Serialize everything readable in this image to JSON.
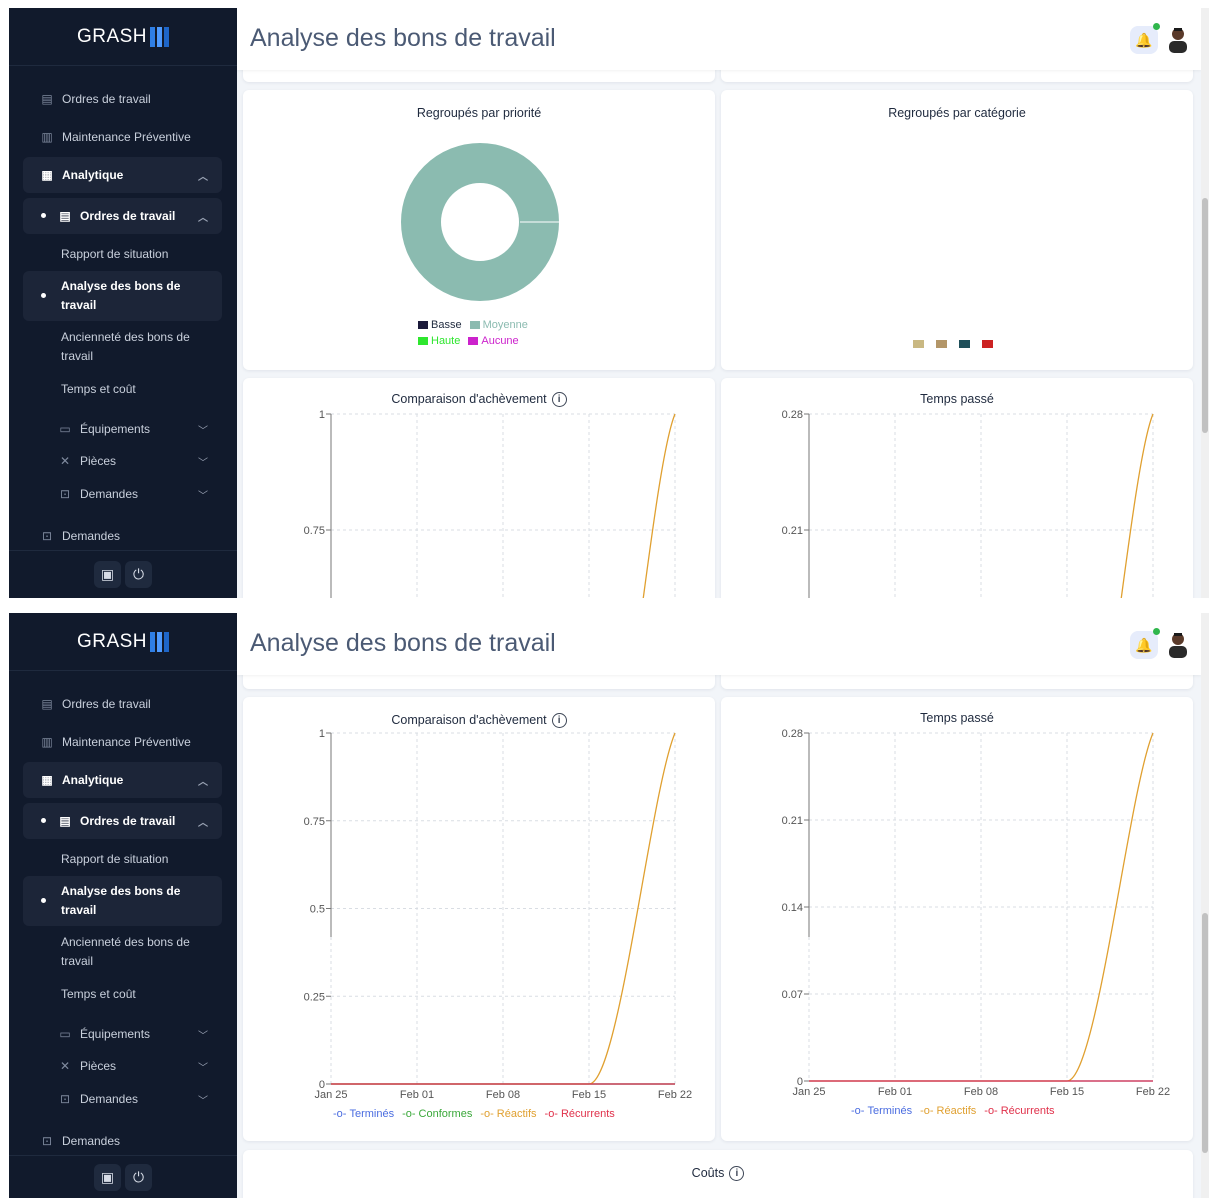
{
  "app": {
    "brand": "GRASH"
  },
  "header": {
    "title": "Analyse des bons de travail"
  },
  "sidebar": {
    "items": [
      {
        "label": "Ordres de travail",
        "icon": "clipboard-icon"
      },
      {
        "label": "Maintenance Préventive",
        "icon": "calendar-clipboard-icon"
      },
      {
        "label": "Analytique",
        "icon": "chart-icon"
      },
      {
        "label": "Ordres de travail",
        "icon": "clipboard-icon"
      },
      {
        "label": "Rapport de situation"
      },
      {
        "label": "Analyse des bons de travail"
      },
      {
        "label": "Ancienneté des bons de travail"
      },
      {
        "label": "Temps et coût"
      },
      {
        "label": "Équipements",
        "icon": "box-icon"
      },
      {
        "label": "Pièces",
        "icon": "tools-icon"
      },
      {
        "label": "Demandes",
        "icon": "inbox-icon"
      },
      {
        "label": "Demandes",
        "icon": "inbox-icon"
      }
    ]
  },
  "cards": {
    "priority": {
      "title": "Regroupés par priorité",
      "legend": [
        {
          "label": "Basse",
          "color": "#1b1a3a"
        },
        {
          "label": "Moyenne",
          "color": "#8bbbb0"
        },
        {
          "label": "Haute",
          "color": "#2ee62e"
        },
        {
          "label": "Aucune",
          "color": "#cc22cc"
        }
      ]
    },
    "category": {
      "title": "Regroupés par catégorie",
      "legend_colors": [
        "#c9b882",
        "#b39668",
        "#1f4f5a",
        "#cc2222"
      ]
    },
    "completion": {
      "title": "Comparaison d'achèvement"
    },
    "time": {
      "title": "Temps passé"
    },
    "costs": {
      "title": "Coûts"
    }
  },
  "chart_data": [
    {
      "type": "pie",
      "title": "Regroupés par priorité",
      "categories": [
        "Basse",
        "Moyenne",
        "Haute",
        "Aucune"
      ],
      "values": [
        0,
        1,
        0,
        0
      ]
    },
    {
      "type": "line",
      "title": "Comparaison d'achèvement",
      "x": [
        "Jan 25",
        "Feb 01",
        "Feb 08",
        "Feb 15",
        "Feb 22"
      ],
      "yticks": [
        "0",
        "0.25",
        "0.5",
        "0.75",
        "1"
      ],
      "ylim": [
        0,
        1
      ],
      "series": [
        {
          "name": "Terminés",
          "color": "#4a6ce0",
          "values": [
            0,
            0,
            0,
            0,
            0
          ]
        },
        {
          "name": "Conformes",
          "color": "#3aa83a",
          "values": [
            0,
            0,
            0,
            0,
            0
          ]
        },
        {
          "name": "Réactifs",
          "color": "#e0a030",
          "values": [
            0,
            0,
            0,
            0,
            1
          ]
        },
        {
          "name": "Récurrents",
          "color": "#e0304a",
          "values": [
            0,
            0,
            0,
            0,
            0
          ]
        }
      ]
    },
    {
      "type": "line",
      "title": "Temps passé",
      "x": [
        "Jan 25",
        "Feb 01",
        "Feb 08",
        "Feb 15",
        "Feb 22"
      ],
      "yticks": [
        "0",
        "0.07",
        "0.14",
        "0.21",
        "0.28"
      ],
      "ylim": [
        0,
        0.28
      ],
      "series": [
        {
          "name": "Terminés",
          "color": "#4a6ce0",
          "values": [
            0,
            0,
            0,
            0,
            0
          ]
        },
        {
          "name": "Réactifs",
          "color": "#e0a030",
          "values": [
            0,
            0,
            0,
            0,
            0.28
          ]
        },
        {
          "name": "Récurrents",
          "color": "#e0304a",
          "values": [
            0,
            0,
            0,
            0,
            0
          ]
        }
      ]
    }
  ]
}
